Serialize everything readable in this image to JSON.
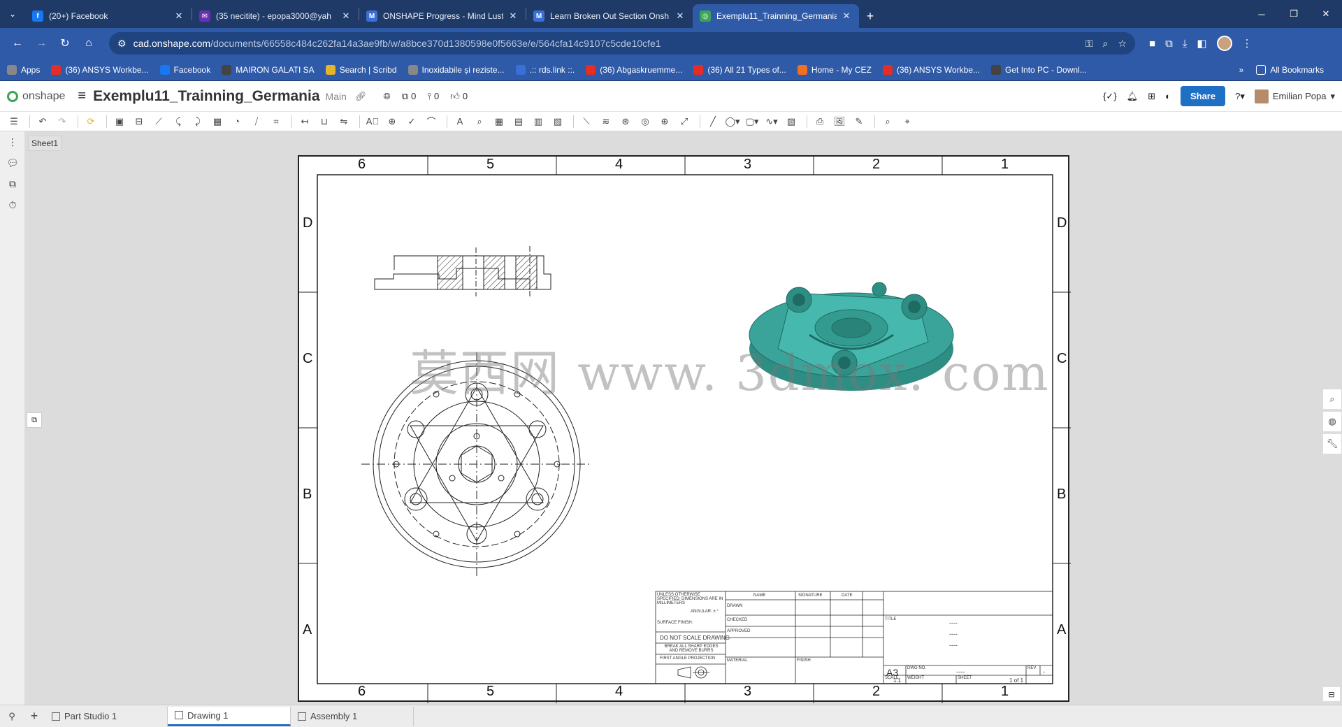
{
  "browser": {
    "tabs": [
      {
        "title": "(20+) Facebook",
        "color": "#1877f2",
        "glyph": "f",
        "active": false
      },
      {
        "title": "(35 necitite) - epopa3000@yah",
        "color": "#6a2fb5",
        "glyph": "✉",
        "active": false
      },
      {
        "title": "ONSHAPE Progress - Mind Lust",
        "color": "#3b6fd8",
        "glyph": "M",
        "active": false
      },
      {
        "title": "Learn Broken Out Section Onsh",
        "color": "#3b6fd8",
        "glyph": "M",
        "active": false
      },
      {
        "title": "Exemplu11_Trainning_Germania",
        "color": "#3aa655",
        "glyph": "◎",
        "active": true
      }
    ],
    "url_host": "cad.onshape.com",
    "url_path": "/documents/66558c484c262fa14a3ae9fb/w/a8bce370d1380598e0f5663e/e/564cfa14c9107c5cde10cfe1",
    "bookmarks": [
      {
        "label": "Apps",
        "color": "#888"
      },
      {
        "label": "(36) ANSYS Workbe...",
        "color": "#e52d27"
      },
      {
        "label": "Facebook",
        "color": "#1877f2"
      },
      {
        "label": "MAIRON GALATI SA",
        "color": "#444"
      },
      {
        "label": "Search | Scribd",
        "color": "#e4b429"
      },
      {
        "label": "Inoxidabile și reziste...",
        "color": "#888"
      },
      {
        "label": ".:: rds.link ::.",
        "color": "#3b6fd8"
      },
      {
        "label": "(36) Abgaskruemme...",
        "color": "#e52d27"
      },
      {
        "label": "(36) All 21 Types of...",
        "color": "#e52d27"
      },
      {
        "label": "Home - My CEZ",
        "color": "#f26f21"
      },
      {
        "label": "(36) ANSYS Workbe...",
        "color": "#e52d27"
      },
      {
        "label": "Get Into PC - Downl...",
        "color": "#444"
      }
    ],
    "all_bookmarks": "All Bookmarks"
  },
  "onshape": {
    "logo_text": "onshape",
    "doc_title": "Exemplu11_Trainning_Germania",
    "branch": "Main",
    "versions_count": "0",
    "branches_count": "0",
    "likes_count": "0",
    "share_label": "Share",
    "user_name": "Emilian Popa",
    "sheet_tab": "Sheet1"
  },
  "drawing": {
    "col_labels": [
      "6",
      "5",
      "4",
      "3",
      "2",
      "1"
    ],
    "row_labels": [
      "D",
      "C",
      "B",
      "A"
    ],
    "watermark": "莫西网 www. 3dmox. com",
    "model_color": "#3aa49a",
    "title_block": {
      "tolerances": "UNLESS OTHERWISE SPECIFIED: DIMENSIONS ARE IN MILLIMETERS",
      "angular": "ANGULAR: ± °",
      "surface": "SURFACE FINISH:",
      "no_scale": "DO NOT SCALE DRAWING",
      "break_edges": "BREAK ALL SHARP EDGES AND REMOVE BURRS",
      "projection": "FIRST ANGLE PROJECTION",
      "hdr_name": "NAME",
      "hdr_signature": "SIGNATURE",
      "hdr_date": "DATE",
      "row_drawn": "DRAWN",
      "row_checked": "CHECKED",
      "row_approved": "APPROVED",
      "material": "MATERIAL",
      "finish": "FINISH",
      "title_label": "TITLE",
      "size": "A3",
      "dwg_no_label": "DWG NO.",
      "dwg_no": "----",
      "rev_label": "REV",
      "rev": "-",
      "scale_label": "SCALE",
      "scale": "1:1",
      "weight_label": "WEIGHT",
      "sheet_label": "SHEET",
      "sheet": "1 of 1",
      "title_lines": [
        "----",
        "----",
        "----"
      ]
    }
  },
  "bottom_tabs": [
    {
      "label": "Part Studio 1",
      "active": false
    },
    {
      "label": "Drawing 1",
      "active": true
    },
    {
      "label": "Assembly 1",
      "active": false
    }
  ]
}
